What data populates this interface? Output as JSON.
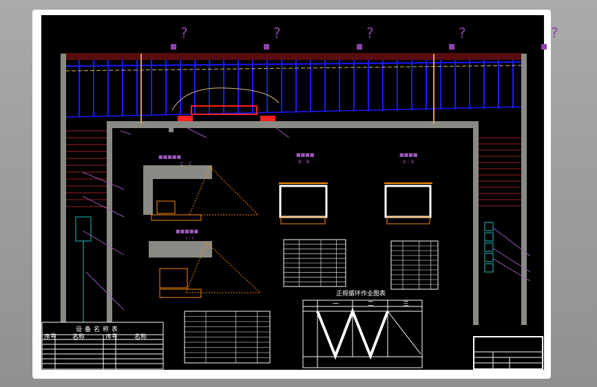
{
  "drawing": {
    "equipment_table": {
      "title": "设备名称表",
      "headers": [
        "序号",
        "名称",
        "序号",
        "名称"
      ]
    },
    "cycle_chart": {
      "title": "正规循环作业图表",
      "shifts": [
        "一",
        "二",
        "三"
      ]
    },
    "section_labels": [
      "C - C",
      "I - I",
      "B - B",
      "A - A"
    ],
    "marker_symbol": "?",
    "colors": {
      "background": "#000000",
      "wall": "#8a8a84",
      "support": "#1a1aff",
      "brick": "#cc2222",
      "equipment": "#ff8c00",
      "annotation": "#9b59b6",
      "lines": "#ffffff"
    }
  }
}
